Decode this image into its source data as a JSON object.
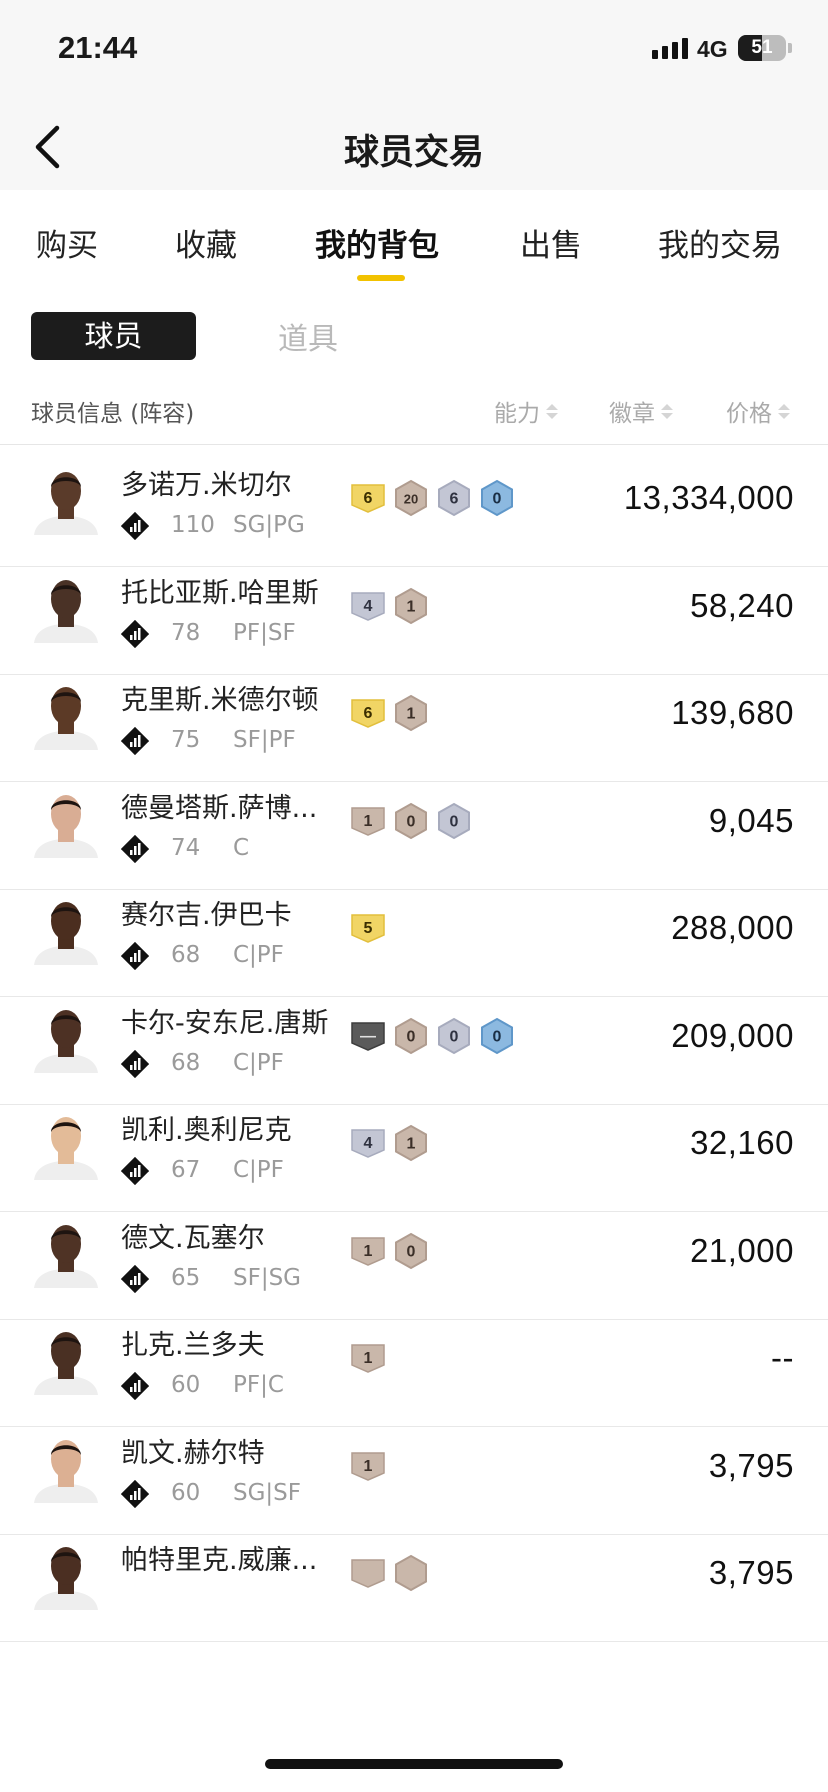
{
  "status_bar": {
    "time": "21:44",
    "network": "4G",
    "battery": "51",
    "battery_level": 0.51
  },
  "nav": {
    "title": "球员交易"
  },
  "tabs": [
    {
      "label": "购买",
      "active": false
    },
    {
      "label": "收藏",
      "active": false
    },
    {
      "label": "我的背包",
      "active": true
    },
    {
      "label": "出售",
      "active": false
    },
    {
      "label": "我的交易",
      "active": false
    }
  ],
  "subtabs": [
    {
      "label": "球员",
      "active": true
    },
    {
      "label": "道具",
      "active": false
    }
  ],
  "table_header": {
    "info": "球员信息 (阵容)",
    "ability": "能力",
    "badge": "徽章",
    "price": "价格"
  },
  "colors": {
    "accent": "#f2c200",
    "gold_badge": "#f1d565",
    "bronze_badge": "#c9b7aa",
    "silver_badge": "#c3c6d4",
    "blue_badge": "#8cb9e0"
  },
  "players": [
    {
      "name": "多诺万.米切尔",
      "rating": "110",
      "position": "SG|PG",
      "price": "13,334,000",
      "skin": "#5a3b2a",
      "badges": [
        {
          "shape": "pent",
          "tier": "gold",
          "value": "6"
        },
        {
          "shape": "hex",
          "tier": "bronze",
          "value": "20"
        },
        {
          "shape": "hex",
          "tier": "silver",
          "value": "6"
        },
        {
          "shape": "hex",
          "tier": "blue",
          "value": "0"
        }
      ]
    },
    {
      "name": "托比亚斯.哈里斯",
      "rating": "78",
      "position": "PF|SF",
      "price": "58,240",
      "skin": "#4a3226",
      "badges": [
        {
          "shape": "pent",
          "tier": "silver",
          "value": "4"
        },
        {
          "shape": "hex",
          "tier": "bronze",
          "value": "1"
        }
      ]
    },
    {
      "name": "克里斯.米德尔顿",
      "rating": "75",
      "position": "SF|PF",
      "price": "139,680",
      "skin": "#5c3a26",
      "badges": [
        {
          "shape": "pent",
          "tier": "gold",
          "value": "6"
        },
        {
          "shape": "hex",
          "tier": "bronze",
          "value": "1"
        }
      ]
    },
    {
      "name": "德曼塔斯.萨博...",
      "rating": "74",
      "position": "C",
      "price": "9,045",
      "skin": "#d9ad94",
      "badges": [
        {
          "shape": "pent",
          "tier": "bronze",
          "value": "1"
        },
        {
          "shape": "hex",
          "tier": "bronze",
          "value": "0"
        },
        {
          "shape": "hex",
          "tier": "silver",
          "value": "0"
        }
      ]
    },
    {
      "name": "赛尔吉.伊巴卡",
      "rating": "68",
      "position": "C|PF",
      "price": "288,000",
      "skin": "#4b2e1f",
      "badges": [
        {
          "shape": "pent",
          "tier": "gold",
          "value": "5"
        }
      ]
    },
    {
      "name": "卡尔-安东尼.唐斯",
      "rating": "68",
      "position": "C|PF",
      "price": "209,000",
      "skin": "#4d3124",
      "badges": [
        {
          "shape": "pent",
          "tier": "dark",
          "value": "—"
        },
        {
          "shape": "hex",
          "tier": "bronze",
          "value": "0"
        },
        {
          "shape": "hex",
          "tier": "silver",
          "value": "0"
        },
        {
          "shape": "hex",
          "tier": "blue",
          "value": "0"
        }
      ]
    },
    {
      "name": "凯利.奥利尼克",
      "rating": "67",
      "position": "C|PF",
      "price": "32,160",
      "skin": "#e3bb98",
      "badges": [
        {
          "shape": "pent",
          "tier": "silver",
          "value": "4"
        },
        {
          "shape": "hex",
          "tier": "bronze",
          "value": "1"
        }
      ]
    },
    {
      "name": "德文.瓦塞尔",
      "rating": "65",
      "position": "SF|SG",
      "price": "21,000",
      "skin": "#4f3325",
      "badges": [
        {
          "shape": "pent",
          "tier": "bronze",
          "value": "1"
        },
        {
          "shape": "hex",
          "tier": "bronze",
          "value": "0"
        }
      ]
    },
    {
      "name": "扎克.兰多夫",
      "rating": "60",
      "position": "PF|C",
      "price": "--",
      "skin": "#4a3023",
      "badges": [
        {
          "shape": "pent",
          "tier": "bronze",
          "value": "1"
        }
      ]
    },
    {
      "name": "凯文.赫尔特",
      "rating": "60",
      "position": "SG|SF",
      "price": "3,795",
      "skin": "#dcb093",
      "badges": [
        {
          "shape": "pent",
          "tier": "bronze",
          "value": "1"
        }
      ]
    },
    {
      "name": "帕特里克.威廉...",
      "rating": "",
      "position": "",
      "price": "3,795",
      "skin": "#4b2f22",
      "badges": [
        {
          "shape": "pent",
          "tier": "bronze",
          "value": ""
        },
        {
          "shape": "hex",
          "tier": "bronze",
          "value": ""
        }
      ]
    }
  ]
}
